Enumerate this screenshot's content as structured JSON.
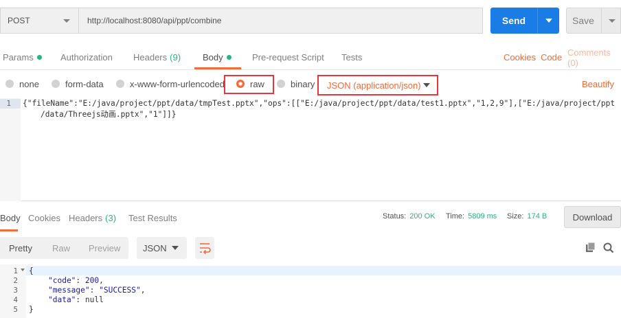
{
  "request": {
    "method": "POST",
    "url": "http://localhost:8080/api/ppt/combine",
    "send_label": "Send",
    "save_label": "Save"
  },
  "request_tabs": {
    "params": "Params",
    "authorization": "Authorization",
    "headers": "Headers",
    "headers_count": "(9)",
    "body": "Body",
    "pre_request": "Pre-request Script",
    "tests": "Tests",
    "cookies": "Cookies",
    "code": "Code",
    "comments": "Comments (0)"
  },
  "body_types": {
    "none": "none",
    "form_data": "form-data",
    "urlencoded": "x-www-form-urlencoded",
    "raw": "raw",
    "binary": "binary",
    "format": "JSON (application/json)",
    "beautify": "Beautify"
  },
  "request_body": {
    "line_number": "1",
    "line_1": "{\"fileName\":\"E:/java/project/ppt/data/tmpTest.pptx\",\"ops\":[[\"E:/java/project/ppt/data/test1.pptx\",\"1,2,9\"],[\"E:/java/project/ppt",
    "line_1_wrap": "/data/Threejs动画.pptx\",\"1\"]]}"
  },
  "response_tabs": {
    "body": "Body",
    "cookies": "Cookies",
    "headers": "Headers",
    "headers_count": "(3)",
    "test_results": "Test Results"
  },
  "response_meta": {
    "status_label": "Status:",
    "status_value": "200 OK",
    "time_label": "Time:",
    "time_value": "5809 ms",
    "size_label": "Size:",
    "size_value": "174 B",
    "download": "Download"
  },
  "response_tools": {
    "pretty": "Pretty",
    "raw": "Raw",
    "preview": "Preview",
    "format": "JSON"
  },
  "response_body": {
    "lines": [
      "1",
      "2",
      "3",
      "4",
      "5"
    ],
    "line_1": "{",
    "line_2_key": "\"code\"",
    "line_2_val": "200",
    "line_3_key": "\"message\"",
    "line_3_val": "\"SUCCESS\"",
    "line_4_key": "\"data\"",
    "line_4_val": "null",
    "line_5": "}"
  },
  "colors": {
    "accent": "#f26b3a",
    "send": "#1a7de6",
    "success": "#26b47f",
    "highlight_box": "#e6353d"
  },
  "icons": [
    "chevron-down-icon",
    "wrap-lines-icon",
    "copy-icon",
    "search-icon"
  ]
}
